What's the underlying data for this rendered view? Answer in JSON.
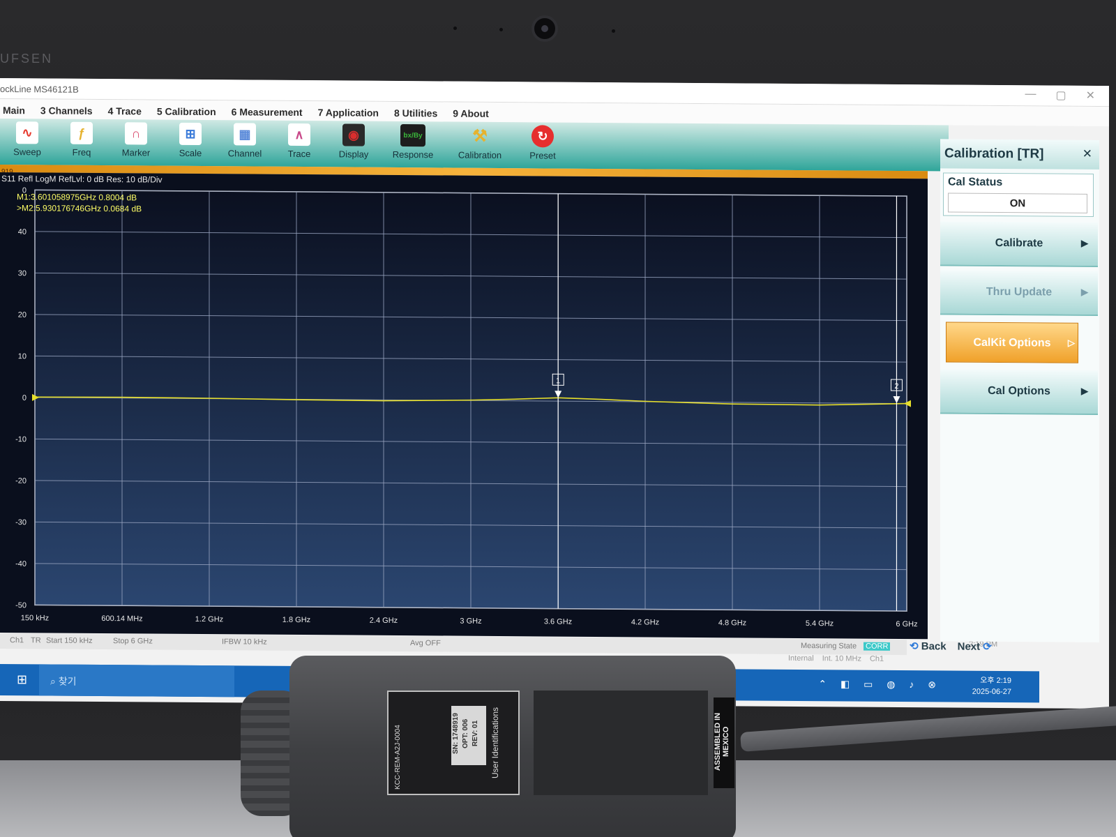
{
  "window": {
    "title": "ockLine MS46121B",
    "controls": [
      "—",
      "▢",
      "✕"
    ]
  },
  "menu": [
    "Main",
    "3 Channels",
    "4 Trace",
    "5 Calibration",
    "6 Measurement",
    "7 Application",
    "8 Utilities",
    "9 About"
  ],
  "toolbar": [
    {
      "label": "Sweep",
      "icon": "sweep-icon",
      "color": "#e63a2e"
    },
    {
      "label": "Freq",
      "icon": "freq-icon",
      "color": "#e6b22e"
    },
    {
      "label": "Marker",
      "icon": "marker-icon",
      "color": "#d9466a"
    },
    {
      "label": "Scale",
      "icon": "scale-icon",
      "color": "#3a7ad9"
    },
    {
      "label": "Channel",
      "icon": "channel-icon",
      "color": "#5a8ad9"
    },
    {
      "label": "Trace",
      "icon": "trace-icon",
      "color": "#c94a8a"
    },
    {
      "label": "Display",
      "icon": "display-icon",
      "color": "#d92e2e"
    },
    {
      "label": "Response",
      "icon": "response-icon",
      "color": "#3ab63a"
    },
    {
      "label": "Calibration",
      "icon": "wrench-icon",
      "color": "#e6b22e"
    },
    {
      "label": "Preset",
      "icon": "preset-icon",
      "color": "#e62e2e"
    }
  ],
  "strip_text": "919",
  "trace_header": "S11 Refl LogM RefLvl: 0  dB Res: 10  dB/Div",
  "markers": {
    "m1": "M1:3.601058975GHz  0.8004  dB",
    "m2": ">M2:5.930176746GHz  0.0684  dB"
  },
  "chart_data": {
    "type": "line",
    "y_ticks": [
      "0",
      "40",
      "30",
      "20",
      "10",
      "0",
      "-10",
      "-20",
      "-30",
      "-40",
      "-50"
    ],
    "x_ticks": [
      "150 kHz",
      "600.14 MHz",
      "1.2 GHz",
      "1.8 GHz",
      "2.4 GHz",
      "3 GHz",
      "3.6 GHz",
      "4.2 GHz",
      "4.8 GHz",
      "5.4 GHz",
      "6 GHz"
    ],
    "ylim": [
      -50,
      50
    ],
    "xlim_ghz": [
      0.00015,
      6
    ],
    "grid": true,
    "series": [
      {
        "x_ghz": [
          0.00015,
          0.6,
          1.2,
          1.8,
          2.4,
          3.0,
          3.3,
          3.6,
          3.9,
          4.2,
          4.8,
          5.4,
          6.0
        ],
        "y_db": [
          0.1,
          0.2,
          0.1,
          -0.1,
          -0.2,
          0.1,
          0.4,
          0.8,
          0.5,
          0.1,
          -0.4,
          -0.5,
          0.0
        ]
      }
    ],
    "marker_positions_ghz": [
      {
        "label": "1",
        "x": 3.601058975,
        "y": 0.8004
      },
      {
        "label": "2",
        "x": 5.930176746,
        "y": 0.0684
      }
    ],
    "trace_color": "#e8e02a"
  },
  "status_bar": {
    "ch": "Ch1",
    "tr": "TR",
    "start": "Start 150 kHz",
    "stop": "Stop 6 GHz",
    "ifbw": "IFBW 10 kHz",
    "avg": "Avg OFF",
    "measuring_state": "Measuring State",
    "corr": "CORR",
    "time": "2:19 PM",
    "internal": "Internal",
    "ref": "Int. 10 MHz",
    "ch1": "Ch1"
  },
  "sidebar": {
    "title": "Calibration [TR]",
    "close": "✕",
    "cal_status_label": "Cal Status",
    "cal_status_value": "ON",
    "buttons": [
      {
        "label": "Calibrate",
        "arrow": "▶"
      },
      {
        "label": "Thru Update",
        "arrow": "▶"
      },
      {
        "label": "CalKit Options",
        "arrow": "▷"
      },
      {
        "label": "Cal Options",
        "arrow": "▶"
      }
    ],
    "back": "Back",
    "next": "Next"
  },
  "taskbar": {
    "search": "찾기",
    "time": "오후 2:19",
    "date": "2025-06-27"
  },
  "bezel_brand": "UFSEN",
  "device": {
    "sn_lines": [
      "SN: 1748919",
      "OPT: 006",
      "REV: 01"
    ],
    "user_id": "User Identifications",
    "kcc": "KCC-REM-A2J-0004",
    "assembled": "ASSEMBLED IN MEXICO"
  }
}
